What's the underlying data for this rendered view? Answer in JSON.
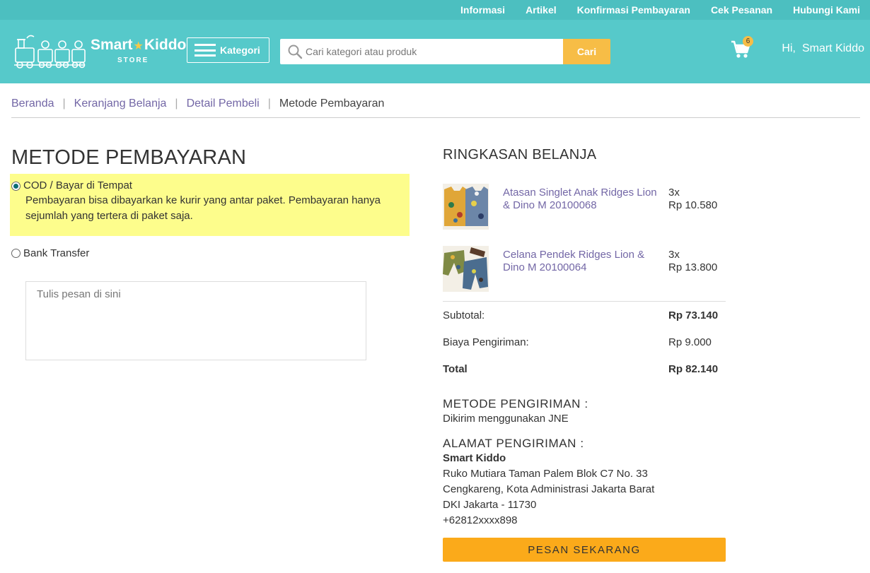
{
  "top_nav": {
    "links": [
      "Informasi",
      "Artikel",
      "Konfirmasi Pembayaran",
      "Cek Pesanan",
      "Hubungi Kami"
    ]
  },
  "header": {
    "logo_name_left": "Smart",
    "logo_name_right": "Kiddo",
    "logo_sub": "STORE",
    "kategori_label": "Kategori",
    "search_placeholder": "Cari kategori atau produk",
    "search_button": "Cari",
    "cart_count": "6",
    "greeting_hi": "Hi,",
    "greeting_name": "Smart Kiddo",
    "brand_color": "#56c9ca",
    "accent_color": "#f7bd46"
  },
  "breadcrumb": {
    "items": [
      "Beranda",
      "Keranjang Belanja",
      "Detail Pembeli"
    ],
    "current": "Metode Pembayaran"
  },
  "payment": {
    "title": "METODE PEMBAYARAN",
    "options": [
      {
        "label": "COD / Bayar di Tempat",
        "description": "Pembayaran bisa dibayarkan ke kurir yang antar paket. Pembayaran hanya sejumlah yang tertera di paket saja.",
        "selected": true
      },
      {
        "label": "Bank Transfer",
        "selected": false
      }
    ],
    "message_placeholder": "Tulis pesan di sini"
  },
  "summary": {
    "title": "RINGKASAN BELANJA",
    "items": [
      {
        "name": "Atasan Singlet Anak Ridges Lion & Dino M 20100068",
        "qty": "3x",
        "price": "Rp 10.580",
        "thumb_icon": "singlet-product-icon"
      },
      {
        "name": "Celana Pendek Ridges Lion & Dino M 20100064",
        "qty": "3x",
        "price": "Rp 13.800",
        "thumb_icon": "shorts-product-icon"
      }
    ],
    "subtotal_label": "Subtotal:",
    "subtotal_value": "Rp 73.140",
    "shipping_label": "Biaya Pengiriman:",
    "shipping_value": "Rp 9.000",
    "total_label": "Total",
    "total_value": "Rp 82.140"
  },
  "shipping_method": {
    "title": "METODE PENGIRIMAN :",
    "text": "Dikirim menggunakan JNE"
  },
  "address": {
    "title": "ALAMAT PENGIRIMAN :",
    "name": "Smart Kiddo",
    "line1": "Ruko Mutiara Taman Palem Blok C7 No. 33",
    "line2": "Cengkareng, Kota Administrasi Jakarta Barat",
    "line3": "DKI Jakarta - 11730",
    "phone": "+62812xxxx898"
  },
  "order_button": "PESAN SEKARANG",
  "order_button_color": "#fbaa1a"
}
